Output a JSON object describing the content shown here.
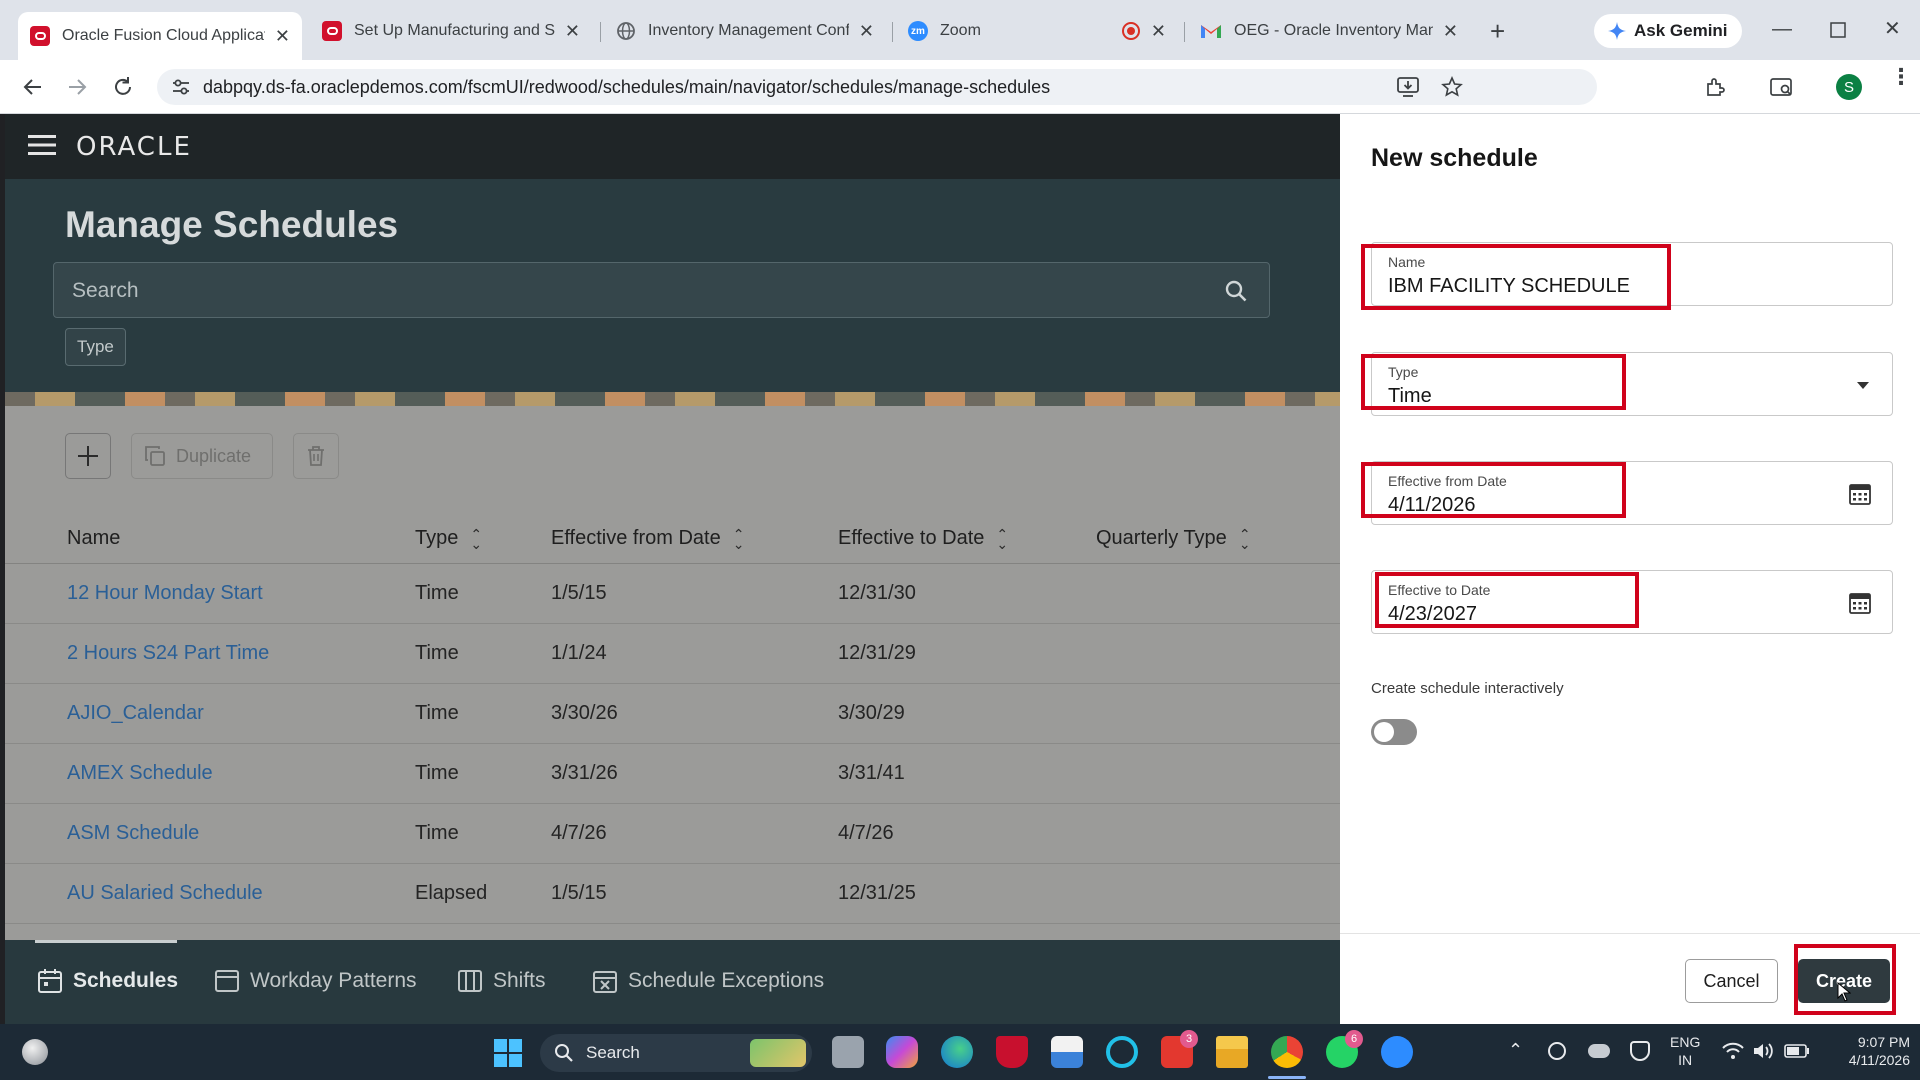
{
  "browser": {
    "tabs": [
      {
        "label": "Oracle Fusion Cloud Applicatio",
        "active": true
      },
      {
        "label": "Set Up Manufacturing and Sup",
        "active": false
      },
      {
        "label": "Inventory Management Config",
        "active": false
      },
      {
        "label": "Zoom",
        "active": false
      },
      {
        "label": "OEG - Oracle Inventory Manag",
        "active": false
      }
    ],
    "ask_gemini": "Ask Gemini",
    "url": "dabpqy.ds-fa.oraclepdemos.com/fscmUI/redwood/schedules/main/navigator/schedules/manage-schedules",
    "profile_initial": "S"
  },
  "app": {
    "logo": "ORACLE",
    "page_title": "Manage Schedules",
    "search": {
      "placeholder": "Search"
    },
    "filter_chip": "Type",
    "toolbar": {
      "duplicate_label": "Duplicate"
    },
    "columns": [
      "Name",
      "Type",
      "Effective from Date",
      "Effective to Date",
      "Quarterly Type"
    ],
    "rows": [
      {
        "name": "12 Hour Monday Start",
        "type": "Time",
        "from": "1/5/15",
        "to": "12/31/30"
      },
      {
        "name": "2 Hours S24 Part Time",
        "type": "Time",
        "from": "1/1/24",
        "to": "12/31/29"
      },
      {
        "name": "AJIO_Calendar",
        "type": "Time",
        "from": "3/30/26",
        "to": "3/30/29"
      },
      {
        "name": "AMEX Schedule",
        "type": "Time",
        "from": "3/31/26",
        "to": "3/31/41"
      },
      {
        "name": "ASM Schedule",
        "type": "Time",
        "from": "4/7/26",
        "to": "4/7/26"
      },
      {
        "name": "AU Salaried Schedule",
        "type": "Elapsed",
        "from": "1/5/15",
        "to": "12/31/25"
      }
    ],
    "bottom_nav": [
      {
        "label": "Schedules",
        "active": true
      },
      {
        "label": "Workday Patterns",
        "active": false
      },
      {
        "label": "Shifts",
        "active": false
      },
      {
        "label": "Schedule Exceptions",
        "active": false
      }
    ]
  },
  "panel": {
    "title": "New schedule",
    "name_label": "Name",
    "name_value": "IBM FACILITY SCHEDULE",
    "type_label": "Type",
    "type_value": "Time",
    "from_label": "Effective from Date",
    "from_value": "4/11/2026",
    "to_label": "Effective to Date",
    "to_value": "4/23/2027",
    "interactive_label": "Create schedule interactively",
    "interactive_on": false,
    "cancel_label": "Cancel",
    "create_label": "Create"
  },
  "taskbar": {
    "search_label": "Search",
    "badges": {
      "office": "3",
      "whatsapp": "6"
    },
    "lang": "ENG",
    "region": "IN",
    "time": "9:07 PM",
    "date": "4/11/2026"
  }
}
